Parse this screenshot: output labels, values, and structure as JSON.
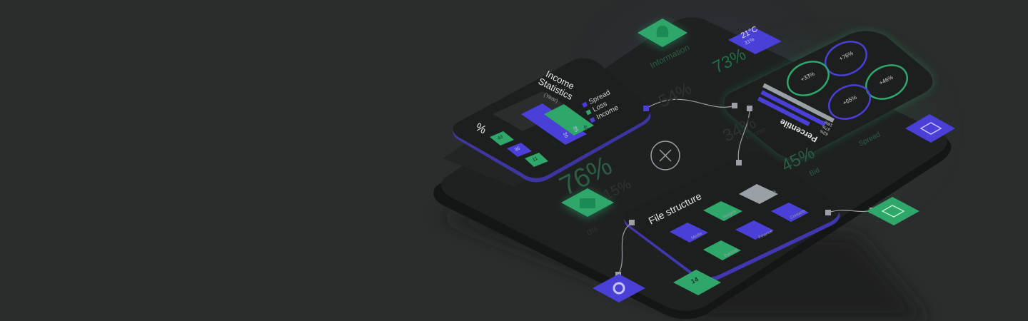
{
  "colors": {
    "background": "#2a2d2c",
    "card": "#1c1f1e",
    "green": "#2fa66a",
    "purple": "#4a3fd6",
    "grey": "#9aa0a6"
  },
  "income": {
    "title_1": "Income",
    "title_2": "Statistics",
    "subtitle": "(Year)",
    "percent_symbol": "%",
    "legend": [
      "Spread",
      "Loss",
      "Income"
    ],
    "bar_labels": [
      "40",
      "36",
      "11",
      "15",
      "36",
      "85",
      "40"
    ]
  },
  "big_stats": {
    "main": "76%",
    "second": "15%",
    "zero": "0%",
    "top_mid": "54%",
    "top_right": "73%",
    "mid": "34%",
    "lower": "45%"
  },
  "labels": {
    "information": "Information",
    "spread": "Spread",
    "bid": "Bid",
    "income": "Income"
  },
  "weather": {
    "temp": "21°C",
    "humidity": "31%"
  },
  "percentile": {
    "title": "Percentile",
    "rings": [
      "+76%",
      "+33%",
      "+46%",
      "+65%"
    ],
    "bars": [
      "63%",
      "37%",
      "18%"
    ]
  },
  "files": {
    "title": "File structure",
    "folders": [
      "Documents",
      "Images",
      "Contacts",
      "Media",
      "Finance",
      "Backup"
    ]
  },
  "icons": [
    "bell-icon",
    "weather-icon",
    "mail-icon",
    "lock-icon",
    "gear-icon",
    "layers-icon",
    "close-icon"
  ],
  "misc": {
    "pill_value": "14"
  }
}
